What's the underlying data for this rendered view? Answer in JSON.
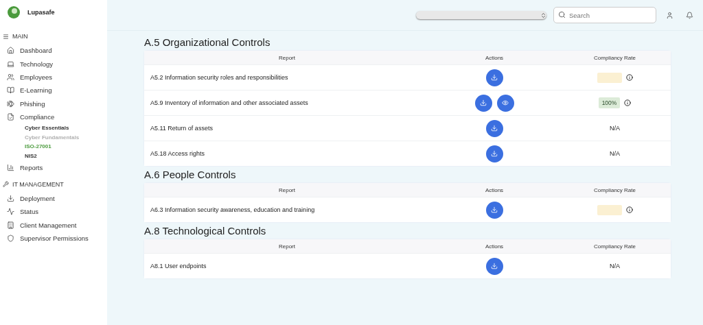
{
  "brand": {
    "name": "Lupasafe"
  },
  "sidebar": {
    "sections": [
      {
        "title": "MAIN",
        "items": [
          {
            "label": "Dashboard"
          },
          {
            "label": "Technology"
          },
          {
            "label": "Employees"
          },
          {
            "label": "E-Learning"
          },
          {
            "label": "Phishing"
          },
          {
            "label": "Compliance",
            "children": [
              {
                "label": "Cyber Essentials",
                "selected": false,
                "disabled": false
              },
              {
                "label": "Cyber Fundamentals",
                "selected": false,
                "disabled": true
              },
              {
                "label": "ISO-27001",
                "selected": true,
                "disabled": false
              },
              {
                "label": "NIS2",
                "selected": false,
                "disabled": false
              }
            ]
          },
          {
            "label": "Reports"
          }
        ]
      },
      {
        "title": "IT MANAGEMENT",
        "items": [
          {
            "label": "Deployment"
          },
          {
            "label": "Status"
          },
          {
            "label": "Client Management"
          },
          {
            "label": "Supervisor Permissions"
          }
        ]
      }
    ]
  },
  "header": {
    "search": {
      "placeholder": "Search"
    }
  },
  "sections": [
    {
      "title": "A.5 Organizational Controls",
      "columns": [
        "Report",
        "Actions",
        "Compliancy Rate"
      ],
      "rows": [
        {
          "report": "A5.2 Information security roles and responsibilities",
          "actions": [
            {
              "kind": "download"
            }
          ],
          "rate": {
            "kind": "pending"
          }
        },
        {
          "report": "A5.9 Inventory of information and other associated assets",
          "actions": [
            {
              "kind": "download"
            },
            {
              "kind": "view"
            }
          ],
          "rate": {
            "kind": "badge",
            "text": "100%"
          }
        },
        {
          "report": "A5.11 Return of assets",
          "actions": [
            {
              "kind": "download"
            }
          ],
          "rate": {
            "kind": "text",
            "text": "N/A"
          }
        },
        {
          "report": "A5.18 Access rights",
          "actions": [
            {
              "kind": "download"
            }
          ],
          "rate": {
            "kind": "text",
            "text": "N/A"
          }
        }
      ]
    },
    {
      "title": "A.6 People Controls",
      "columns": [
        "Report",
        "Actions",
        "Compliancy Rate"
      ],
      "rows": [
        {
          "report": "A6.3 Information security awareness, education and training",
          "actions": [
            {
              "kind": "download"
            }
          ],
          "rate": {
            "kind": "pending"
          }
        }
      ]
    },
    {
      "title": "A.8 Technological Controls",
      "columns": [
        "Report",
        "Actions",
        "Compliancy Rate"
      ],
      "rows": [
        {
          "report": "A8.1 User endpoints",
          "actions": [
            {
              "kind": "download"
            }
          ],
          "rate": {
            "kind": "text",
            "text": "N/A"
          }
        }
      ]
    }
  ]
}
